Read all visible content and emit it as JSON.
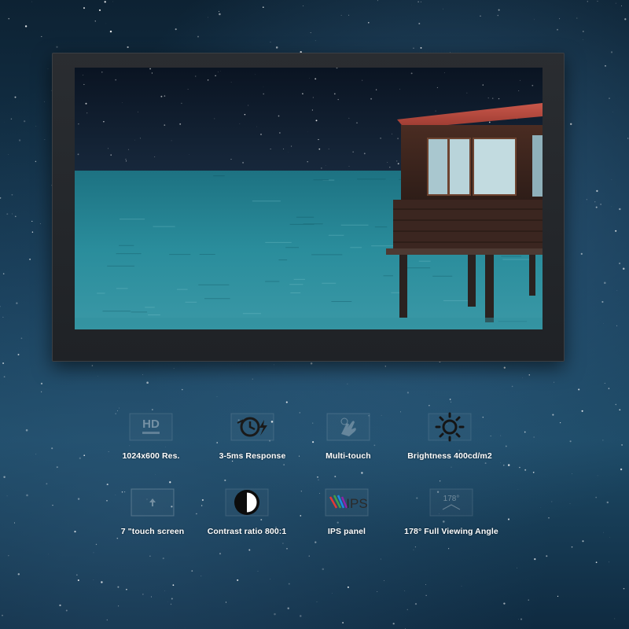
{
  "features": [
    {
      "label": "1024x600 Res.",
      "icon": "hd-icon",
      "icon_text": "HD"
    },
    {
      "label": "3-5ms Response",
      "icon": "response-clock-icon"
    },
    {
      "label": "Multi-touch",
      "icon": "touch-hand-icon"
    },
    {
      "label": "Brightness 400cd/m2",
      "icon": "sun-brightness-icon"
    },
    {
      "label": "7 \"touch screen",
      "icon": "screen-size-icon"
    },
    {
      "label": "Contrast ratio 800:1",
      "icon": "contrast-icon"
    },
    {
      "label": "IPS panel",
      "icon": "ips-icon",
      "icon_text": "IPS"
    },
    {
      "label": "178° Full Viewing Angle",
      "icon": "viewing-angle-icon",
      "icon_text": "178°"
    }
  ],
  "colors": {
    "bezel": "#24272b",
    "roof": "#b5443a",
    "sea": "#2a8d9c",
    "sky": "#101c2c",
    "label": "#ffffff"
  }
}
